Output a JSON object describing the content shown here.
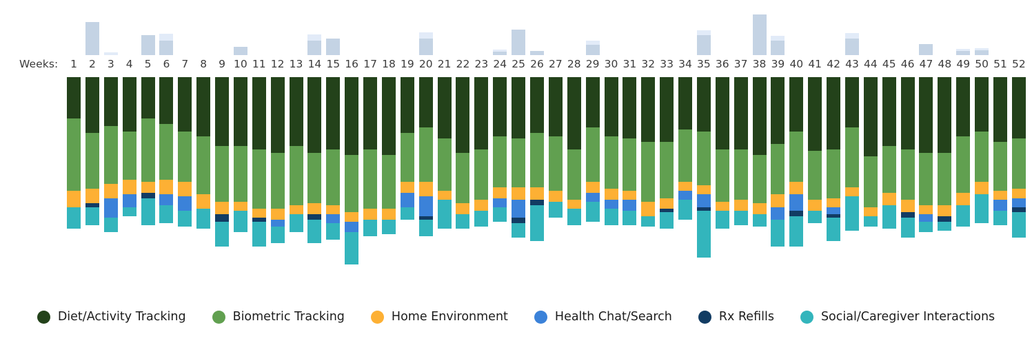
{
  "chart_data": {
    "type": "bar",
    "title": "",
    "subtitle": "",
    "xlabel": "Weeks:",
    "ylabel": "",
    "stacked": true,
    "orientation": "vertical-hanging",
    "grid": false,
    "legend_position": "bottom",
    "axis_note": "Bars hang downward from a common baseline at the top; segment order top-to-bottom is Diet/Activity Tracking, Biometric Tracking, Home Environment, Health Chat/Search, Rx Refills, Social/Caregiver Interactions.",
    "ylim": [
      0,
      100
    ],
    "categories": [
      "1",
      "2",
      "3",
      "4",
      "5",
      "6",
      "7",
      "8",
      "9",
      "10",
      "11",
      "12",
      "13",
      "14",
      "15",
      "16",
      "17",
      "18",
      "19",
      "20",
      "21",
      "22",
      "23",
      "24",
      "25",
      "26",
      "27",
      "28",
      "29",
      "30",
      "31",
      "32",
      "33",
      "34",
      "35",
      "36",
      "37",
      "38",
      "39",
      "40",
      "41",
      "42",
      "43",
      "44",
      "45",
      "46",
      "47",
      "48",
      "49",
      "50",
      "51",
      "52"
    ],
    "series": [
      {
        "name": "Diet/Activity Tracking",
        "color": "#23421A",
        "values": [
          23,
          31,
          27,
          30,
          23,
          26,
          30,
          33,
          38,
          38,
          40,
          42,
          38,
          42,
          40,
          43,
          40,
          43,
          31,
          28,
          34,
          42,
          40,
          33,
          34,
          31,
          33,
          40,
          28,
          33,
          34,
          36,
          36,
          29,
          30,
          40,
          40,
          43,
          37,
          30,
          41,
          40,
          28,
          44,
          38,
          40,
          42,
          42,
          33,
          30,
          36,
          34
        ]
      },
      {
        "name": "Biometric Tracking",
        "color": "#61A050",
        "values": [
          40,
          31,
          32,
          27,
          35,
          31,
          28,
          32,
          31,
          31,
          33,
          31,
          33,
          28,
          31,
          32,
          33,
          30,
          27,
          30,
          29,
          28,
          28,
          28,
          27,
          30,
          30,
          28,
          30,
          29,
          29,
          33,
          31,
          29,
          30,
          29,
          28,
          27,
          28,
          28,
          27,
          27,
          33,
          28,
          26,
          28,
          29,
          29,
          31,
          28,
          27,
          28
        ]
      },
      {
        "name": "Home Environment",
        "color": "#FDB034",
        "values": [
          9,
          8,
          8,
          8,
          6,
          8,
          8,
          8,
          7,
          5,
          5,
          6,
          5,
          6,
          5,
          5,
          6,
          6,
          6,
          8,
          5,
          6,
          6,
          6,
          7,
          7,
          6,
          5,
          6,
          6,
          5,
          8,
          6,
          5,
          5,
          5,
          6,
          6,
          7,
          7,
          6,
          5,
          5,
          5,
          7,
          7,
          5,
          6,
          7,
          7,
          5,
          5
        ]
      },
      {
        "name": "Health Chat/Search",
        "color": "#3B82D9",
        "values": [
          0,
          0,
          11,
          7,
          0,
          6,
          8,
          0,
          0,
          0,
          0,
          4,
          0,
          0,
          5,
          6,
          0,
          0,
          8,
          11,
          0,
          0,
          0,
          5,
          10,
          0,
          0,
          0,
          5,
          5,
          6,
          0,
          0,
          5,
          7,
          0,
          0,
          0,
          7,
          9,
          0,
          4,
          0,
          0,
          0,
          0,
          4,
          0,
          0,
          0,
          6,
          5
        ]
      },
      {
        "name": "Rx Refills",
        "color": "#123C63",
        "values": [
          0,
          2,
          0,
          0,
          3,
          0,
          0,
          0,
          4,
          0,
          2,
          0,
          0,
          3,
          0,
          0,
          0,
          0,
          0,
          2,
          0,
          0,
          0,
          0,
          3,
          3,
          0,
          0,
          0,
          0,
          0,
          0,
          2,
          0,
          2,
          0,
          0,
          0,
          0,
          3,
          0,
          2,
          0,
          0,
          0,
          3,
          0,
          3,
          0,
          0,
          0,
          3
        ]
      },
      {
        "name": "Social/Caregiver Interactions",
        "color": "#33B5BC",
        "values": [
          12,
          10,
          8,
          5,
          15,
          10,
          9,
          11,
          14,
          12,
          14,
          9,
          10,
          13,
          9,
          18,
          9,
          8,
          7,
          9,
          16,
          8,
          9,
          8,
          8,
          20,
          9,
          9,
          11,
          9,
          8,
          6,
          9,
          11,
          26,
          10,
          8,
          7,
          15,
          17,
          7,
          13,
          19,
          6,
          13,
          11,
          6,
          5,
          12,
          16,
          8,
          14
        ]
      }
    ],
    "overlay_series": [
      {
        "name": "overlay-upper",
        "color": "#E2EBF8",
        "values": [
          0,
          0,
          4,
          0,
          0,
          9,
          0,
          0,
          0,
          0,
          0,
          0,
          0,
          8,
          0,
          0,
          0,
          0,
          0,
          8,
          0,
          0,
          0,
          3,
          0,
          0,
          0,
          0,
          6,
          0,
          0,
          0,
          0,
          0,
          7,
          0,
          0,
          0,
          6,
          0,
          0,
          0,
          7,
          0,
          0,
          0,
          0,
          0,
          3,
          3,
          0,
          0
        ]
      },
      {
        "name": "overlay-lower",
        "color": "#C4D3E4",
        "values": [
          0,
          47,
          0,
          0,
          28,
          21,
          0,
          0,
          0,
          12,
          0,
          0,
          0,
          21,
          24,
          0,
          0,
          0,
          0,
          24,
          0,
          0,
          0,
          5,
          36,
          6,
          0,
          0,
          15,
          0,
          0,
          0,
          0,
          0,
          28,
          0,
          0,
          58,
          21,
          0,
          0,
          0,
          24,
          0,
          0,
          0,
          16,
          0,
          6,
          7,
          0,
          0
        ]
      }
    ]
  },
  "axis": {
    "title": "Weeks:"
  },
  "legend": {
    "items": [
      {
        "label": "Diet/Activity Tracking",
        "color": "#23421A"
      },
      {
        "label": "Biometric Tracking",
        "color": "#61A050"
      },
      {
        "label": "Home Environment",
        "color": "#FDB034"
      },
      {
        "label": "Health Chat/Search",
        "color": "#3B82D9"
      },
      {
        "label": "Rx Refills",
        "color": "#123C63"
      },
      {
        "label": "Social/Caregiver Interactions",
        "color": "#33B5BC"
      }
    ]
  }
}
